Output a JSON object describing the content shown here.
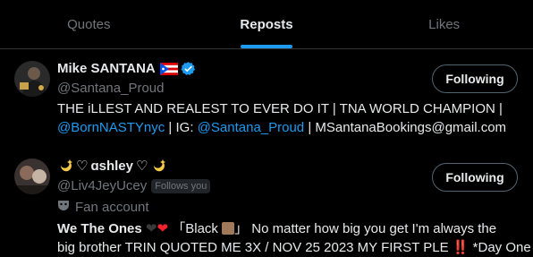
{
  "tabs": [
    {
      "label": "Quotes",
      "active": false
    },
    {
      "label": "Reposts",
      "active": true
    },
    {
      "label": "Likes",
      "active": false
    }
  ],
  "users": [
    {
      "name": "Mike SANTANA",
      "handle": "@Santana_Proud",
      "follow_label": "Following",
      "bio_text1": "THE iLLEST AND REALEST TO EVER DO IT | TNA WORLD CHAMPION |",
      "bio_link1": "@BornNASTYnyc",
      "bio_sep1": " | IG: ",
      "bio_link2": "@Santana_Proud",
      "bio_sep2": " | MSantanaBookings@gmail.com"
    },
    {
      "name": "ɑshley",
      "handle": "@Liv4JeyUcey",
      "follows_you": "Follows you",
      "follow_label": "Following",
      "fan_label": "Fan account",
      "bio_bold": "We The Ones",
      "bio_text1": "「Black",
      "bio_text2": "」 No matter how big you get I'm always the",
      "bio_line2": "big brother TRIN QUOTED ME 3X / NOV 25 2023 MY FIRST PLE ‼️ *Day One"
    }
  ],
  "colors": {
    "accent": "#1d9bf0",
    "background": "#000000",
    "text_primary": "#e7e9ea",
    "text_secondary": "#71767b"
  }
}
